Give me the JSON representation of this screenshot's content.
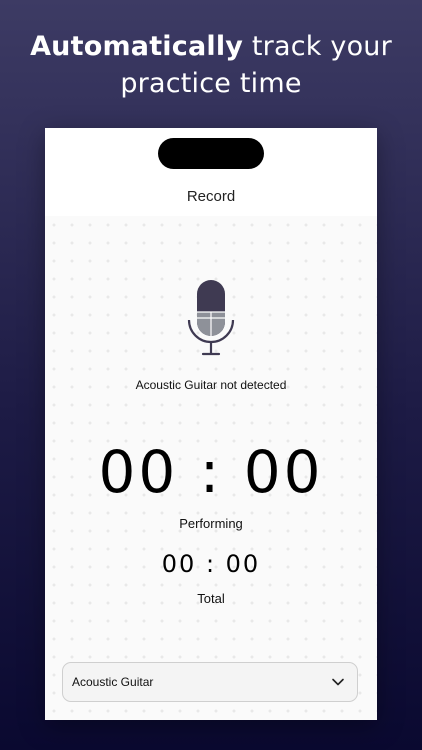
{
  "promo": {
    "headline_bold": "Automatically",
    "headline_rest": " track your",
    "headline_line2": "practice time"
  },
  "nav": {
    "title": "Record"
  },
  "detector": {
    "status": "Acoustic Guitar not detected",
    "icon": "microphone-icon"
  },
  "timers": {
    "performing_time": "00 : 00",
    "performing_label": "Performing",
    "total_time": "00 : 00",
    "total_label": "Total"
  },
  "instrument_select": {
    "selected": "Acoustic Guitar",
    "icon": "chevron-down-icon"
  },
  "colors": {
    "background_top": "#3d3b64",
    "background_bottom": "#0a0930",
    "mic_body": "#3f3a52",
    "mic_bottom": "#8e9199"
  }
}
